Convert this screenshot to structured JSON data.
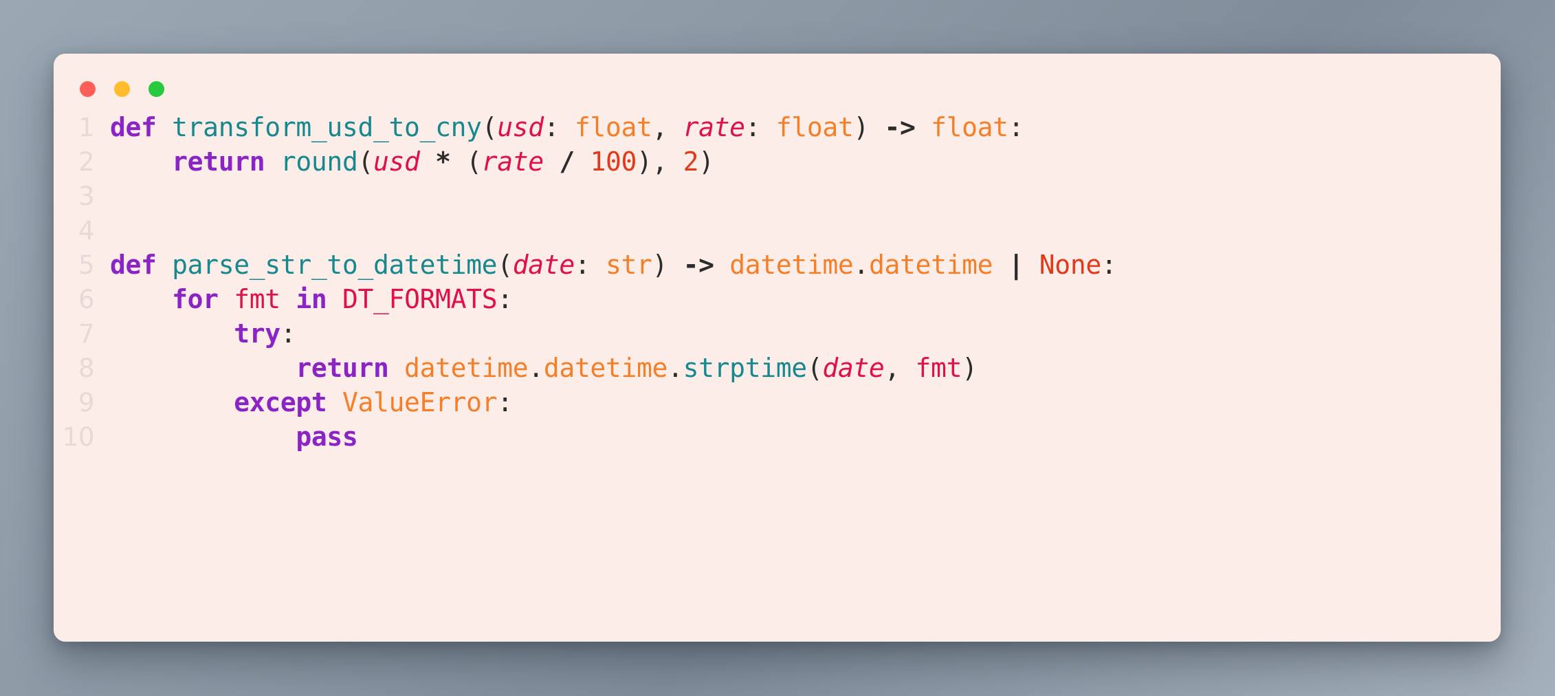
{
  "window": {
    "traffic_lights": [
      {
        "name": "close",
        "color": "#FF5F56"
      },
      {
        "name": "minimize",
        "color": "#FFBD2E"
      },
      {
        "name": "maximize",
        "color": "#27C93F"
      }
    ],
    "background_color": "#FDEDE8"
  },
  "editor": {
    "language": "python",
    "line_numbers": [
      "1",
      "2",
      "3",
      "4",
      "5",
      "6",
      "7",
      "8",
      "9",
      "10"
    ],
    "lines": [
      {
        "number": "1",
        "text": "def transform_usd_to_cny(usd: float, rate: float) -> float:",
        "tokens": [
          {
            "t": "def",
            "c": "kw"
          },
          {
            "t": " ",
            "c": "punc"
          },
          {
            "t": "transform_usd_to_cny",
            "c": "fn"
          },
          {
            "t": "(",
            "c": "punc"
          },
          {
            "t": "usd",
            "c": "var"
          },
          {
            "t": ": ",
            "c": "punc"
          },
          {
            "t": "float",
            "c": "typ"
          },
          {
            "t": ", ",
            "c": "punc"
          },
          {
            "t": "rate",
            "c": "var"
          },
          {
            "t": ": ",
            "c": "punc"
          },
          {
            "t": "float",
            "c": "typ"
          },
          {
            "t": ") ",
            "c": "punc"
          },
          {
            "t": "->",
            "c": "op"
          },
          {
            "t": " ",
            "c": "punc"
          },
          {
            "t": "float",
            "c": "typ"
          },
          {
            "t": ":",
            "c": "punc"
          }
        ]
      },
      {
        "number": "2",
        "text": "    return round(usd * (rate / 100), 2)",
        "tokens": [
          {
            "t": "    ",
            "c": "punc"
          },
          {
            "t": "return",
            "c": "kw"
          },
          {
            "t": " ",
            "c": "punc"
          },
          {
            "t": "round",
            "c": "fn"
          },
          {
            "t": "(",
            "c": "punc"
          },
          {
            "t": "usd",
            "c": "var"
          },
          {
            "t": " ",
            "c": "punc"
          },
          {
            "t": "*",
            "c": "op"
          },
          {
            "t": " (",
            "c": "punc"
          },
          {
            "t": "rate",
            "c": "var"
          },
          {
            "t": " ",
            "c": "punc"
          },
          {
            "t": "/",
            "c": "op"
          },
          {
            "t": " ",
            "c": "punc"
          },
          {
            "t": "100",
            "c": "num"
          },
          {
            "t": "), ",
            "c": "punc"
          },
          {
            "t": "2",
            "c": "num"
          },
          {
            "t": ")",
            "c": "punc"
          }
        ]
      },
      {
        "number": "3",
        "text": "",
        "tokens": []
      },
      {
        "number": "4",
        "text": "",
        "tokens": []
      },
      {
        "number": "5",
        "text": "def parse_str_to_datetime(date: str) -> datetime.datetime | None:",
        "tokens": [
          {
            "t": "def",
            "c": "kw"
          },
          {
            "t": " ",
            "c": "punc"
          },
          {
            "t": "parse_str_to_datetime",
            "c": "fn"
          },
          {
            "t": "(",
            "c": "punc"
          },
          {
            "t": "date",
            "c": "var"
          },
          {
            "t": ": ",
            "c": "punc"
          },
          {
            "t": "str",
            "c": "typ"
          },
          {
            "t": ") ",
            "c": "punc"
          },
          {
            "t": "->",
            "c": "op"
          },
          {
            "t": " ",
            "c": "punc"
          },
          {
            "t": "datetime",
            "c": "typ"
          },
          {
            "t": ".",
            "c": "punc"
          },
          {
            "t": "datetime",
            "c": "typ"
          },
          {
            "t": " ",
            "c": "punc"
          },
          {
            "t": "|",
            "c": "op"
          },
          {
            "t": " ",
            "c": "punc"
          },
          {
            "t": "None",
            "c": "cnst"
          },
          {
            "t": ":",
            "c": "punc"
          }
        ]
      },
      {
        "number": "6",
        "text": "    for fmt in DT_FORMATS:",
        "tokens": [
          {
            "t": "    ",
            "c": "punc"
          },
          {
            "t": "for",
            "c": "kw"
          },
          {
            "t": " ",
            "c": "punc"
          },
          {
            "t": "fmt",
            "c": "name"
          },
          {
            "t": " ",
            "c": "punc"
          },
          {
            "t": "in",
            "c": "kw"
          },
          {
            "t": " ",
            "c": "punc"
          },
          {
            "t": "DT_FORMATS",
            "c": "name"
          },
          {
            "t": ":",
            "c": "punc"
          }
        ]
      },
      {
        "number": "7",
        "text": "        try:",
        "tokens": [
          {
            "t": "        ",
            "c": "punc"
          },
          {
            "t": "try",
            "c": "kw"
          },
          {
            "t": ":",
            "c": "punc"
          }
        ]
      },
      {
        "number": "8",
        "text": "            return datetime.datetime.strptime(date, fmt)",
        "tokens": [
          {
            "t": "            ",
            "c": "punc"
          },
          {
            "t": "return",
            "c": "kw"
          },
          {
            "t": " ",
            "c": "punc"
          },
          {
            "t": "datetime",
            "c": "typ"
          },
          {
            "t": ".",
            "c": "punc"
          },
          {
            "t": "datetime",
            "c": "typ"
          },
          {
            "t": ".",
            "c": "punc"
          },
          {
            "t": "strptime",
            "c": "fn"
          },
          {
            "t": "(",
            "c": "punc"
          },
          {
            "t": "date",
            "c": "var"
          },
          {
            "t": ", ",
            "c": "punc"
          },
          {
            "t": "fmt",
            "c": "name"
          },
          {
            "t": ")",
            "c": "punc"
          }
        ]
      },
      {
        "number": "9",
        "text": "        except ValueError:",
        "tokens": [
          {
            "t": "        ",
            "c": "punc"
          },
          {
            "t": "except",
            "c": "kw"
          },
          {
            "t": " ",
            "c": "punc"
          },
          {
            "t": "ValueError",
            "c": "typ"
          },
          {
            "t": ":",
            "c": "punc"
          }
        ]
      },
      {
        "number": "10",
        "text": "            pass",
        "tokens": [
          {
            "t": "            ",
            "c": "punc"
          },
          {
            "t": "pass",
            "c": "kw"
          }
        ]
      }
    ]
  },
  "theme": {
    "keyword": "#8B24C4",
    "function": "#17888D",
    "type": "#F57F28",
    "number": "#E03A1A",
    "variable": "#E01048",
    "punctuation": "#2C2C2C",
    "line_number": "#E6D9D7",
    "background": "#FDEDE8"
  }
}
